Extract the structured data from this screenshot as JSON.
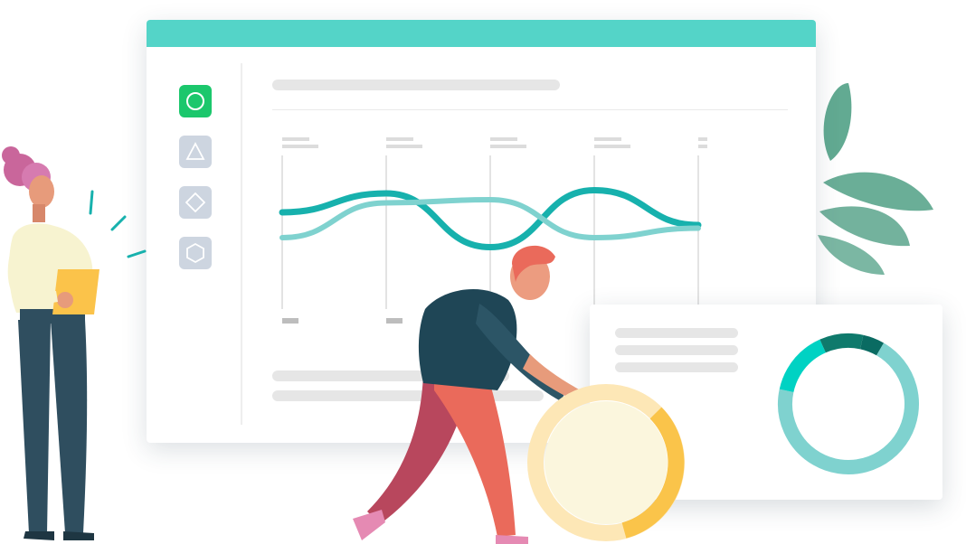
{
  "theme": {
    "titlebar_color": "#54d4c8",
    "active_icon_bg": "#1bc76c",
    "inactive_icon_bg": "#cdd5e0",
    "wave_dark": "#17b1ad",
    "wave_light": "#7fd2cf",
    "donut_colors": [
      "#7fd2cf",
      "#00d2c3",
      "#0f7a6c",
      "#0a6b62"
    ],
    "coin_colors": [
      "#fde7b6",
      "#fac44a",
      "#fbf6dd"
    ],
    "leaf_color": "#5aa58c"
  },
  "sidebar": {
    "items": [
      {
        "icon": "circle-icon",
        "active": true
      },
      {
        "icon": "triangle-icon",
        "active": false
      },
      {
        "icon": "diamond-icon",
        "active": false
      },
      {
        "icon": "hexagon-icon",
        "active": false
      }
    ]
  },
  "chart_data": {
    "type": "line",
    "series": [
      {
        "values": [
          0.2,
          0.8,
          -0.9,
          0.9,
          -0.2
        ]
      },
      {
        "values": [
          -0.6,
          0.5,
          0.6,
          -0.6,
          -0.3
        ]
      }
    ]
  },
  "donut_data": {
    "type": "pie",
    "values": [
      70,
      15,
      10,
      5
    ]
  },
  "illustration": {
    "people": [
      "woman-with-clipboard",
      "man-pushing-coin"
    ],
    "objects": [
      "coin",
      "plant-leaves"
    ]
  }
}
